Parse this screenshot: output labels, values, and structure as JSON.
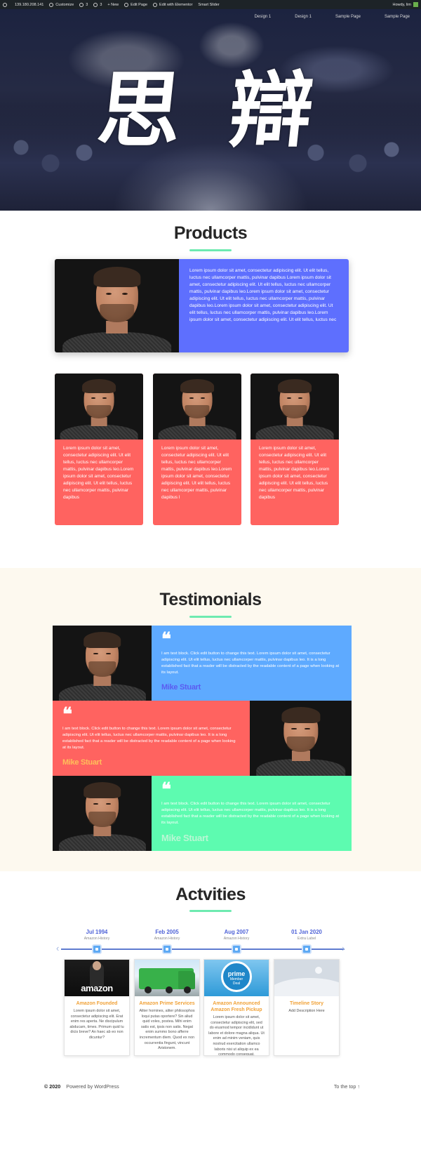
{
  "admin_bar": {
    "items": [
      "139.180.208.141",
      "Customize",
      "3",
      "3",
      "New",
      "Edit Page",
      "Edit with Elementor",
      "Smart Slider"
    ],
    "greeting": "Howdy, lim"
  },
  "hero": {
    "nav": [
      "Design 1",
      "Design 1",
      "Sample Page",
      "Sample Page"
    ],
    "title": "思 辯"
  },
  "products": {
    "heading": "Products",
    "featured_text": "Lorem ipsum dolor sit amet, consectetur adipiscing elit. Ut elit tellus, luctus nec ullamcorper mattis, pulvinar dapibus Lorem ipsum dolor sit amet, consectetur adipiscing elit. Ut elit tellus, luctus nec ullamcorper mattis, pulvinar dapibus leo.Lorem ipsum dolor sit amet, consectetur adipiscing elit. Ut elit tellus, luctus nec ullamcorper mattis, pulvinar dapibus leo.Lorem ipsum dolor sit amet, consectetur adipiscing elit. Ut elit tellus, luctus nec ullamcorper mattis, pulvinar dapibus leo.Lorem ipsum dolor sit amet, consectetur adipiscing elit. Ut elit tellus, luctus nec",
    "cards": [
      {
        "text": "Lorem ipsum dolor sit amet, consectetur adipiscing elit. Ut elit tellus, luctus nec ullamcorper mattis, pulvinar dapibus leo.Lorem ipsum dolor sit amet, consectetur adipiscing elit. Ut elit tellus, luctus nec ullamcorper mattis, pulvinar dapibus"
      },
      {
        "text": "Lorem ipsum dolor sit amet, consectetur adipiscing elit. Ut elit tellus, luctus nec ullamcorper mattis, pulvinar dapibus leo.Lorem ipsum dolor sit amet, consectetur adipiscing elit. Ut elit tellus, luctus nec ullamcorper mattis, pulvinar dapibus l"
      },
      {
        "text": "Lorem ipsum dolor sit amet, consectetur adipiscing elit. Ut elit tellus, luctus nec ullamcorper mattis, pulvinar dapibus leo.Lorem ipsum dolor sit amet, consectetur adipiscing elit. Ut elit tellus, luctus nec ullamcorper mattis, pulvinar dapibus"
      }
    ]
  },
  "testimonials": {
    "heading": "Testimonials",
    "quote_glyph": "❝",
    "items": [
      {
        "text": "I am text block. Click edit button to change this text. Lorem ipsum dolor sit amet, consectetur adipiscing elit. Ut elit tellus, luctus nec ullamcorper mattis, pulvinar dapibus leo. It is a long established fact that a reader will be distracted by the readable content of a page when looking at its layout.",
        "name": "Mike Stuart",
        "box_color": "#5eaaff",
        "name_color": "#5b5cf0"
      },
      {
        "text": "I am text block. Click edit button to change this text. Lorem ipsum dolor sit amet, consectetur adipiscing elit. Ut elit tellus, luctus nec ullamcorper mattis, pulvinar dapibus leo. It is a long established fact that a reader will be distracted by the readable content of a page when looking at its layout.",
        "name": "Mike Stuart",
        "box_color": "#ff6360",
        "name_color": "#ffbf5a"
      },
      {
        "text": "I am text block. Click edit button to change this text. Lorem ipsum dolor sit amet, consectetur adipiscing elit. Ut elit tellus, luctus nec ullamcorper mattis, pulvinar dapibus leo. It is a long established fact that a reader will be distracted by the readable content of a page when looking at its layout.",
        "name": "Mike Stuart",
        "box_color": "#5dfbb0",
        "name_color": "#b9f7d4"
      }
    ]
  },
  "activities": {
    "heading": "Actvities",
    "events": [
      {
        "date": "Jul 1994",
        "label": "Amazon History",
        "title": "Amazon Founded",
        "desc": "Lorem ipsum dolor sit amet, consectetur adipiscing elit. Erat enim res aperta. Ne discipulum abducam, times. Primum quid tu dicis breve? An haec ab eo non dicuntur?",
        "image": "amazon-logo-image"
      },
      {
        "date": "Feb 2005",
        "label": "Amazon History",
        "title": "Amazon Prime Services",
        "desc": "Aliter homines, aliter philosophos loqui putas oportere? Sin aliud quid voles, postea. Mihi enim satis est, ipsis non satis. Negat enim summo bono afferre incrementum diem. Quod ex non occurrentia fingunt, vincunt Aristonem.",
        "image": "delivery-truck-image"
      },
      {
        "date": "Aug 2007",
        "label": "Amazon History",
        "title": "Amazon Announced Amazon Fresh Pickup",
        "desc": "Lorem ipsum dolor sit amet, consectetur adipiscing elit, sed do eiusmod tempor incididunt ut labore et dolore magna aliqua. Ut enim ad minim veniam, quis nostrud exercitation ullamco laboris nisi ut aliquip ex ea commodo consequat.",
        "image": "prime-member-deal-image",
        "image_text": {
          "brand": "prime",
          "line1": "Member",
          "line2": "Deal"
        }
      },
      {
        "date": "01 Jan 2020",
        "label": "Extra Label",
        "title": "Timeline Story",
        "desc": "Add Description Here",
        "image": "placeholder-image"
      }
    ],
    "amazon_logo_text": "amazon"
  },
  "footer": {
    "copyright": "© 2020",
    "powered": "Powered by WordPress",
    "to_top": "To the top ↑"
  },
  "colors": {
    "accent_line": "#6eeab0",
    "product_feature": "#5e6ffe",
    "product_card": "#ff6360",
    "timeline_date": "#4f63d8",
    "timeline_title": "#f0a136"
  }
}
